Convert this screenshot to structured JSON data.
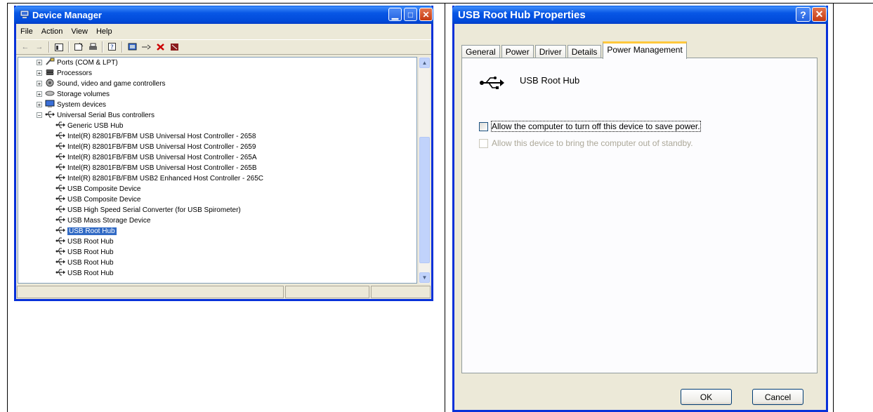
{
  "device_manager": {
    "title": "Device Manager",
    "menu": [
      "File",
      "Action",
      "View",
      "Help"
    ],
    "tree": [
      {
        "label": "Ports (COM & LPT)",
        "level": 1,
        "icon": "port-icon",
        "expander": "+"
      },
      {
        "label": "Processors",
        "level": 1,
        "icon": "processor-icon",
        "expander": "+"
      },
      {
        "label": "Sound, video and game controllers",
        "level": 1,
        "icon": "sound-icon",
        "expander": "+"
      },
      {
        "label": "Storage volumes",
        "level": 1,
        "icon": "storage-icon",
        "expander": "+"
      },
      {
        "label": "System devices",
        "level": 1,
        "icon": "system-icon",
        "expander": "+"
      },
      {
        "label": "Universal Serial Bus controllers",
        "level": 1,
        "icon": "usb-icon",
        "expander": "−"
      },
      {
        "label": "Generic USB Hub",
        "level": 2,
        "icon": "usb-icon"
      },
      {
        "label": "Intel(R) 82801FB/FBM USB Universal Host Controller - 2658",
        "level": 2,
        "icon": "usb-icon"
      },
      {
        "label": "Intel(R) 82801FB/FBM USB Universal Host Controller - 2659",
        "level": 2,
        "icon": "usb-icon"
      },
      {
        "label": "Intel(R) 82801FB/FBM USB Universal Host Controller - 265A",
        "level": 2,
        "icon": "usb-icon"
      },
      {
        "label": "Intel(R) 82801FB/FBM USB Universal Host Controller - 265B",
        "level": 2,
        "icon": "usb-icon"
      },
      {
        "label": "Intel(R) 82801FB/FBM USB2 Enhanced Host Controller - 265C",
        "level": 2,
        "icon": "usb-icon"
      },
      {
        "label": "USB Composite Device",
        "level": 2,
        "icon": "usb-icon"
      },
      {
        "label": "USB Composite Device",
        "level": 2,
        "icon": "usb-icon"
      },
      {
        "label": "USB High Speed Serial Converter (for USB Spirometer)",
        "level": 2,
        "icon": "usb-icon"
      },
      {
        "label": "USB Mass Storage Device",
        "level": 2,
        "icon": "usb-icon"
      },
      {
        "label": "USB Root Hub",
        "level": 2,
        "icon": "usb-icon",
        "selected": true
      },
      {
        "label": "USB Root Hub",
        "level": 2,
        "icon": "usb-icon"
      },
      {
        "label": "USB Root Hub",
        "level": 2,
        "icon": "usb-icon"
      },
      {
        "label": "USB Root Hub",
        "level": 2,
        "icon": "usb-icon"
      },
      {
        "label": "USB Root Hub",
        "level": 2,
        "icon": "usb-icon"
      }
    ]
  },
  "properties": {
    "title": "USB Root Hub Properties",
    "tabs": [
      "General",
      "Power",
      "Driver",
      "Details",
      "Power Management"
    ],
    "active_tab": "Power Management",
    "device_name": "USB Root Hub",
    "options": [
      {
        "label": "Allow the computer to turn off this device to save power.",
        "checked": false,
        "enabled": true
      },
      {
        "label": "Allow this device to bring the computer out of standby.",
        "checked": false,
        "enabled": false
      }
    ],
    "ok_label": "OK",
    "cancel_label": "Cancel"
  }
}
